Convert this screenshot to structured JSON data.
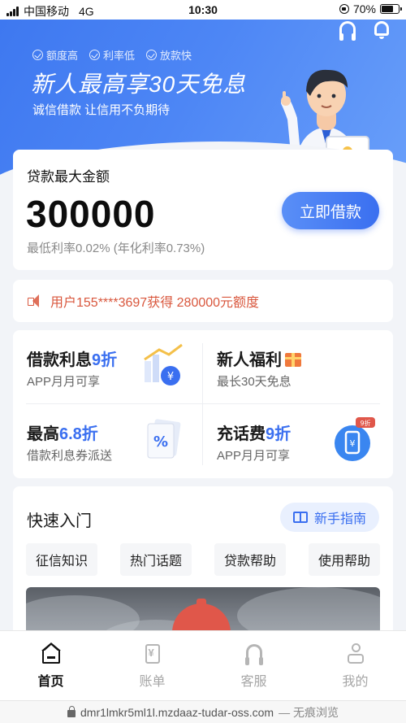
{
  "status_bar": {
    "carrier": "中国移动",
    "network": "4G",
    "time": "10:30",
    "battery_text": "70%",
    "battery_level": 0.7
  },
  "hero": {
    "tags": [
      "额度高",
      "利率低",
      "放款快"
    ],
    "title": "新人最高享30天免息",
    "subtitle": "诚信借款 让信用不负期待"
  },
  "loan": {
    "label": "贷款最大金额",
    "amount": "300000",
    "rate": "最低利率0.02% (年化利率0.73%)",
    "button": "立即借款"
  },
  "notice": {
    "text": "用户155****3697获得 280000元额度"
  },
  "promos": [
    {
      "title_pre": "借款利息",
      "title_hl": "9折",
      "subtitle": "APP月月可享"
    },
    {
      "title_pre": "新人福利",
      "title_hl": "",
      "subtitle": "最长30天免息"
    },
    {
      "title_pre": "最高",
      "title_hl": "6.8折",
      "subtitle": "借款利息券派送"
    },
    {
      "title_pre": "充话费",
      "title_hl": "9折",
      "subtitle": "APP月月可享",
      "badge": "9折"
    }
  ],
  "quick_entry": {
    "title": "快速入门",
    "guide_button": "新手指南",
    "chips": [
      "征信知识",
      "热门话题",
      "贷款帮助",
      "使用帮助"
    ]
  },
  "tabs": [
    {
      "label": "首页",
      "icon": "home-icon",
      "active": true
    },
    {
      "label": "账单",
      "icon": "bill-icon",
      "active": false
    },
    {
      "label": "客服",
      "icon": "headset-icon",
      "active": false
    },
    {
      "label": "我的",
      "icon": "profile-icon",
      "active": false
    }
  ],
  "url_bar": {
    "url": "dmr1lmkr5ml1l.mzdaaz-tudar-oss.com",
    "mode": "— 无痕浏览"
  },
  "colors": {
    "accent": "#3a6ff0",
    "notice": "#d9573d",
    "hero_start": "#3e78f0",
    "hero_end": "#6aa0fa"
  }
}
